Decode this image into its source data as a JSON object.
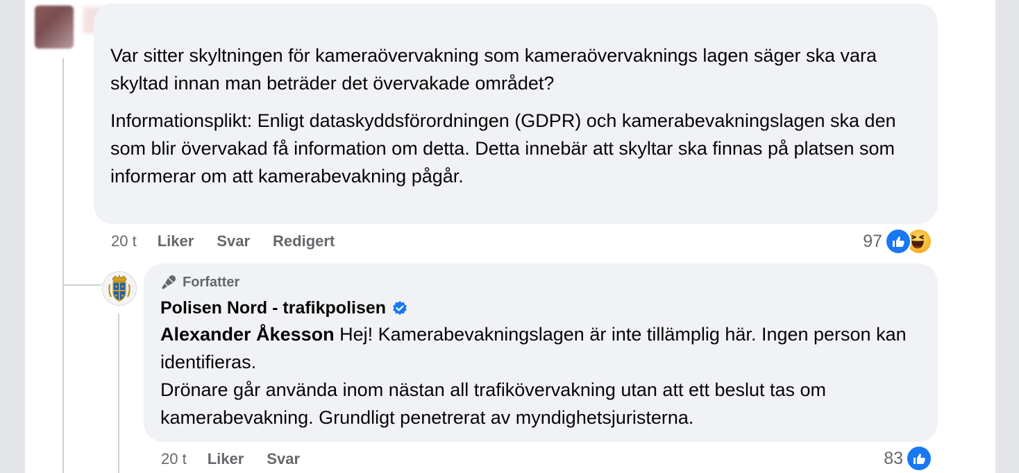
{
  "comment": {
    "paragraph_1": "Var sitter skyltningen för kameraövervakning som kameraövervaknings lagen säger ska vara skyltad innan man beträder det övervakade området?",
    "paragraph_2": "Informationsplikt: Enligt dataskyddsförordningen (GDPR) och kamerabevakningslagen ska den som blir övervakad få information om detta. Detta innebär att skyltar ska finnas på platsen som informerar om att kamerabevakning pågår.",
    "timestamp": "20 t",
    "like_label": "Liker",
    "reply_label": "Svar",
    "edited_label": "Redigert",
    "reaction_count": "97",
    "reaction_icons": [
      "like-icon",
      "haha-icon"
    ]
  },
  "reply": {
    "badge_label": "Forfatter",
    "page_name": "Polisen Nord - trafikpolisen",
    "verified_icon": "verified-badge-icon",
    "mention": "Alexander Åkesson",
    "line_1": " Hej! Kamerabevakningslagen är inte tillämplig här. Ingen person kan identifieras.",
    "line_2": "Drönare går använda inom nästan all trafikövervakning utan att ett beslut tas om kamerabevakning. Grundligt penetrerat av myndighetsjuristerna.",
    "timestamp": "20 t",
    "like_label": "Liker",
    "reply_label": "Svar",
    "reaction_count": "83",
    "reaction_icons": [
      "like-icon"
    ]
  },
  "colors": {
    "bubble": "#f0f2f5",
    "meta_text": "#65676b",
    "like_blue": "#1877f2",
    "thread_line": "#ced0d4"
  }
}
